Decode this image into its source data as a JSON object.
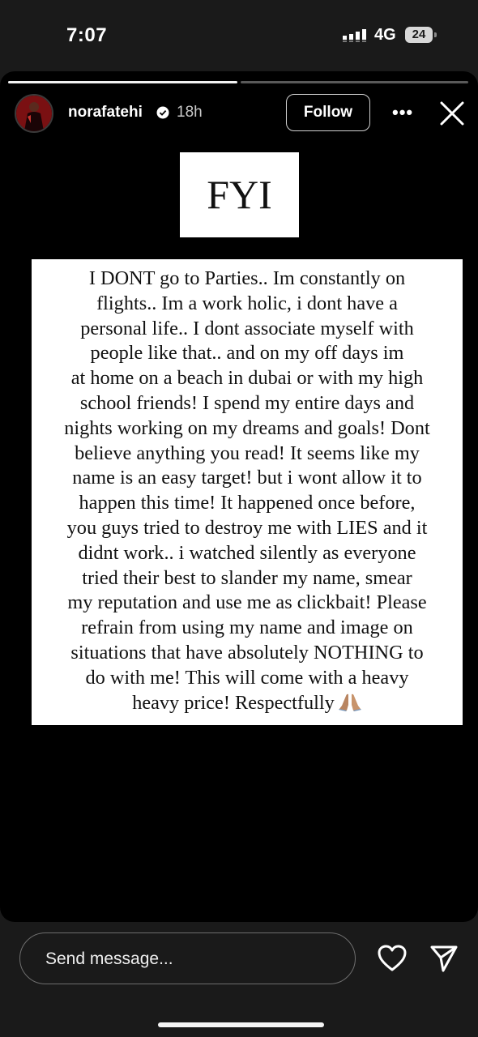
{
  "status_bar": {
    "time": "7:07",
    "network": "4G",
    "battery": "24"
  },
  "story_header": {
    "username": "norafatehi",
    "time_ago": "18h",
    "follow_label": "Follow",
    "more_label": "•••"
  },
  "story_content": {
    "title": "FYI",
    "message_lines": [
      "I DONT go to Parties.. Im constantly on",
      "flights.. Im a work holic, i dont have a",
      "personal life.. I dont associate myself with",
      "people like that.. and on my off days im",
      "at home on a beach in dubai or with my high",
      "school friends! I spend my entire days and",
      "nights working on my dreams and goals! Dont",
      "believe anything you read! It seems like my",
      "name is an easy target! but i wont allow it to",
      "happen this time! It happened once before,",
      "you guys tried to destroy me with LIES and it",
      "didnt work.. i watched silently as everyone",
      "tried their best to slander my name, smear",
      "my reputation and use me as clickbait! Please",
      "refrain from using my name and image on",
      "situations that have absolutely NOTHING to",
      "do with me! This will come with a heavy",
      "heavy price!  Respectfully"
    ],
    "emoji": "folded-hands"
  },
  "reply_bar": {
    "placeholder": "Send message..."
  },
  "icons": [
    "signal-icon",
    "verified-badge-icon",
    "close-icon",
    "heart-icon",
    "send-icon"
  ],
  "colors": {
    "background": "#000000",
    "text": "#ffffff",
    "card": "#ffffff"
  }
}
